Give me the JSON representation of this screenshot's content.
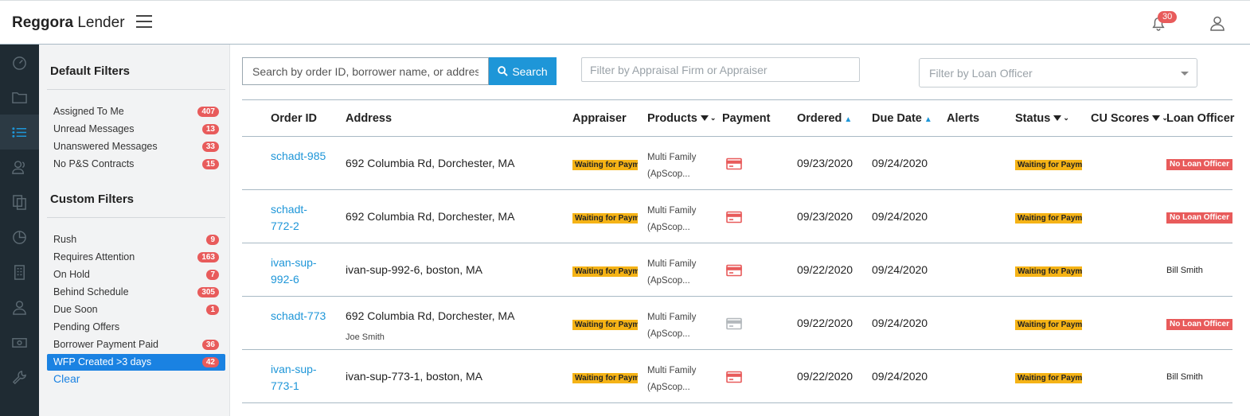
{
  "header": {
    "brand_bold": "Reggora",
    "brand_rest": " Lender",
    "notification_count": "30"
  },
  "rail": {
    "icons": [
      "dashboard-icon",
      "folder-icon",
      "list-icon",
      "users-icon",
      "documents-icon",
      "pie-chart-icon",
      "building-icon",
      "user-icon",
      "money-icon",
      "wrench-icon"
    ],
    "active_index": 2
  },
  "filters": {
    "default_title": "Default Filters",
    "default_items": [
      {
        "label": "Assigned To Me",
        "count": "407"
      },
      {
        "label": "Unread Messages",
        "count": "13"
      },
      {
        "label": "Unanswered Messages",
        "count": "33"
      },
      {
        "label": "No P&S Contracts",
        "count": "15"
      }
    ],
    "custom_title": "Custom Filters",
    "custom_items": [
      {
        "label": "Rush",
        "count": "9"
      },
      {
        "label": "Requires Attention",
        "count": "163"
      },
      {
        "label": "On Hold",
        "count": "7"
      },
      {
        "label": "Behind Schedule",
        "count": "305"
      },
      {
        "label": "Due Soon",
        "count": "1"
      },
      {
        "label": "Pending Offers",
        "count": ""
      },
      {
        "label": "Borrower Payment Paid",
        "count": "36"
      },
      {
        "label": "WFP Created >3 days",
        "count": "42"
      }
    ],
    "clear_label": "Clear"
  },
  "search": {
    "placeholder": "Search by order ID, borrower name, or address",
    "button_label": "Search",
    "firm_placeholder": "Filter by Appraisal Firm or Appraiser",
    "loan_officer_placeholder": "Filter by Loan Officer"
  },
  "table": {
    "headers": {
      "order_id": "Order ID",
      "address": "Address",
      "appraiser": "Appraiser",
      "products": "Products",
      "payment": "Payment",
      "ordered": "Ordered",
      "due_date": "Due Date",
      "alerts": "Alerts",
      "status": "Status",
      "cu_scores": "CU Scores",
      "loan_officer": "Loan Officer"
    },
    "rows": [
      {
        "order_id": "schadt-985",
        "address": "692 Columbia Rd, Dorchester, MA",
        "address_sub": "",
        "appraiser": "Waiting for Payment",
        "product_line1": "Multi Family",
        "product_line2": "(ApScop...",
        "payment_color": "#e85b5b",
        "ordered": "09/23/2020",
        "due": "09/24/2020",
        "status": "Waiting for Payment",
        "loan_officer": "No Loan Officer",
        "lo_tag": true
      },
      {
        "order_id": "schadt-772-2",
        "address": "692 Columbia Rd, Dorchester, MA",
        "address_sub": "",
        "appraiser": "Waiting for Payment",
        "product_line1": "Multi Family",
        "product_line2": "(ApScop...",
        "payment_color": "#e85b5b",
        "ordered": "09/23/2020",
        "due": "09/24/2020",
        "status": "Waiting for Payment",
        "loan_officer": "No Loan Officer",
        "lo_tag": true
      },
      {
        "order_id": "ivan-sup-992-6",
        "address": "ivan-sup-992-6, boston, MA",
        "address_sub": "",
        "appraiser": "Waiting for Payment",
        "product_line1": "Multi Family",
        "product_line2": "(ApScop...",
        "payment_color": "#e85b5b",
        "ordered": "09/22/2020",
        "due": "09/24/2020",
        "status": "Waiting for Payment",
        "loan_officer": "Bill Smith",
        "lo_tag": false
      },
      {
        "order_id": "schadt-773",
        "address": "692 Columbia Rd, Dorchester, MA",
        "address_sub": "Joe Smith",
        "appraiser": "Waiting for Payment",
        "product_line1": "Multi Family",
        "product_line2": "(ApScop...",
        "payment_color": "#b3b8bc",
        "ordered": "09/22/2020",
        "due": "09/24/2020",
        "status": "Waiting for Payment",
        "loan_officer": "No Loan Officer",
        "lo_tag": true
      },
      {
        "order_id": "ivan-sup-773-1",
        "address": "ivan-sup-773-1, boston, MA",
        "address_sub": "",
        "appraiser": "Waiting for Payment",
        "product_line1": "Multi Family",
        "product_line2": "(ApScop...",
        "payment_color": "#e85b5b",
        "ordered": "09/22/2020",
        "due": "09/24/2020",
        "status": "Waiting for Payment",
        "loan_officer": "Bill Smith",
        "lo_tag": false
      }
    ]
  }
}
